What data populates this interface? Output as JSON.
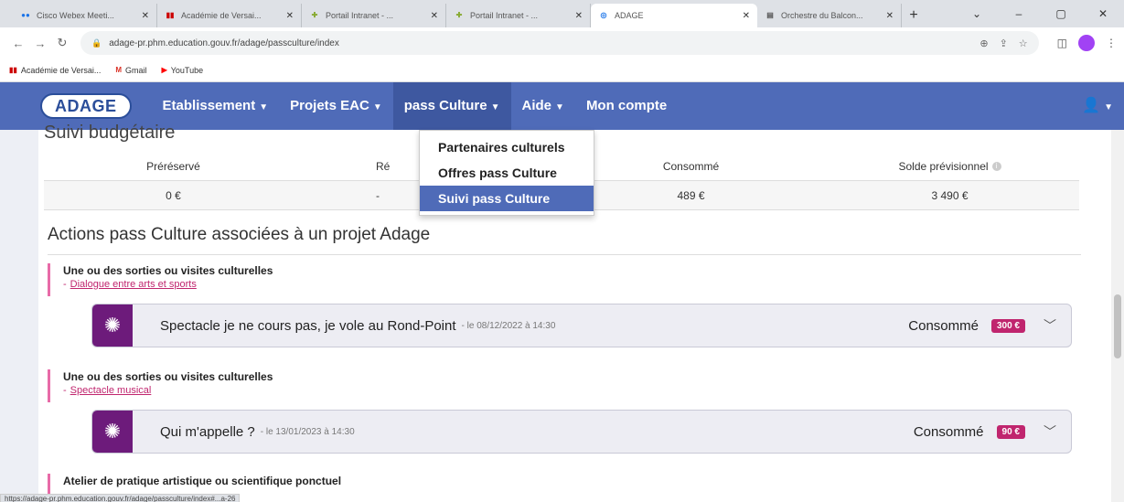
{
  "browser": {
    "tabs": [
      {
        "label": "Cisco Webex Meeti...",
        "active": false
      },
      {
        "label": "Académie de Versai...",
        "active": false
      },
      {
        "label": "Portail Intranet - ...",
        "active": false
      },
      {
        "label": "Portail Intranet - ...",
        "active": false
      },
      {
        "label": "ADAGE",
        "active": true
      },
      {
        "label": "Orchestre du Balcon...",
        "active": false
      }
    ],
    "url": "adage-pr.phm.education.gouv.fr/adage/passculture/index",
    "bookmarks": [
      "Académie de Versai...",
      "Gmail",
      "YouTube"
    ]
  },
  "nav": {
    "logo": "ADAGE",
    "items": [
      {
        "label": "Etablissement",
        "caret": true
      },
      {
        "label": "Projets EAC",
        "caret": true
      },
      {
        "label": "pass Culture",
        "caret": true
      },
      {
        "label": "Aide",
        "caret": true
      },
      {
        "label": "Mon compte",
        "caret": false
      }
    ]
  },
  "dropdown": {
    "items": [
      "Partenaires culturels",
      "Offres pass Culture",
      "Suivi pass Culture"
    ]
  },
  "budget": {
    "title": "Suivi budgétaire",
    "headers": [
      "Préréservé",
      "Ré",
      "Consommé",
      "Solde prévisionnel"
    ],
    "values": [
      "0 €",
      "-",
      "489 €",
      "3 490 €"
    ]
  },
  "actions": {
    "title": "Actions pass Culture associées à un projet Adage",
    "groups": [
      {
        "title": "Une ou des sorties ou visites culturelles",
        "project": "Dialogue entre arts et sports",
        "card": {
          "name": "Spectacle je ne cours pas, je vole au Rond-Point",
          "date": "- le 08/12/2022 à 14:30",
          "status": "Consommé",
          "amount": "300 €"
        }
      },
      {
        "title": "Une ou des sorties ou visites culturelles",
        "project": "Spectacle musical",
        "card": {
          "name": "Qui m'appelle ?",
          "date": "- le 13/01/2023 à 14:30",
          "status": "Consommé",
          "amount": "90 €"
        }
      },
      {
        "title": "Atelier de pratique artistique ou scientifique ponctuel"
      }
    ]
  },
  "statusbar": "https://adage-pr.phm.education.gouv.fr/adage/passculture/index#...a-26"
}
